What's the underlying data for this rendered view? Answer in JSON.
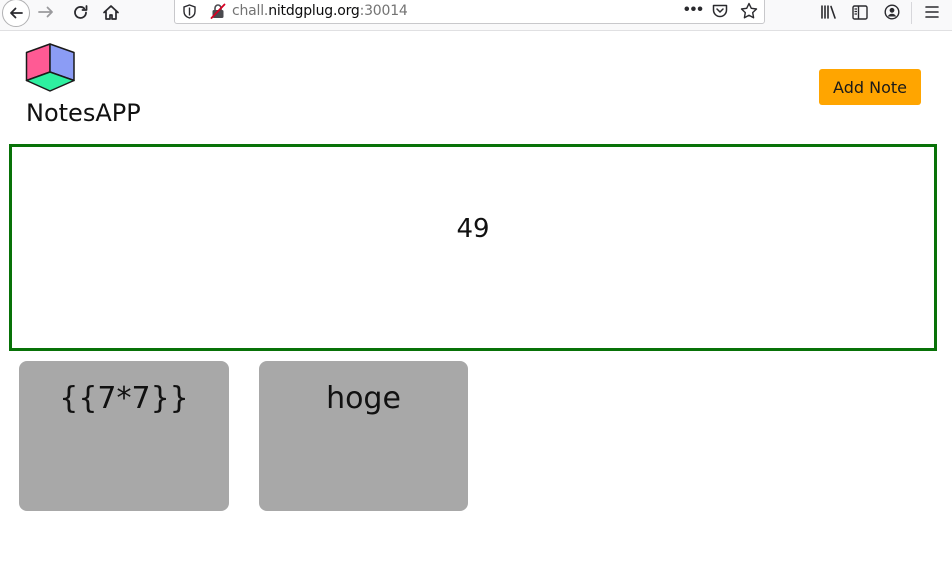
{
  "browser": {
    "url_host": "chall.",
    "url_domain": "nitdgplug.org",
    "url_port": ":30014",
    "page_actions_label": "•••",
    "icons": [
      "back-icon",
      "forward-icon",
      "reload-icon",
      "home-icon",
      "shield-icon",
      "insecure-lock-icon",
      "pocket-icon",
      "star-icon",
      "library-icon",
      "sidebar-icon",
      "account-icon",
      "hamburger-menu-icon"
    ]
  },
  "app": {
    "brand": "NotesAPP",
    "add_note_label": "Add Note",
    "result": "49",
    "notes": [
      {
        "title": "{{7*7}}"
      },
      {
        "title": "hoge"
      }
    ],
    "colors": {
      "accent": "#ffa500",
      "result_border": "#087208",
      "note_bg": "#a8a8a8"
    }
  }
}
